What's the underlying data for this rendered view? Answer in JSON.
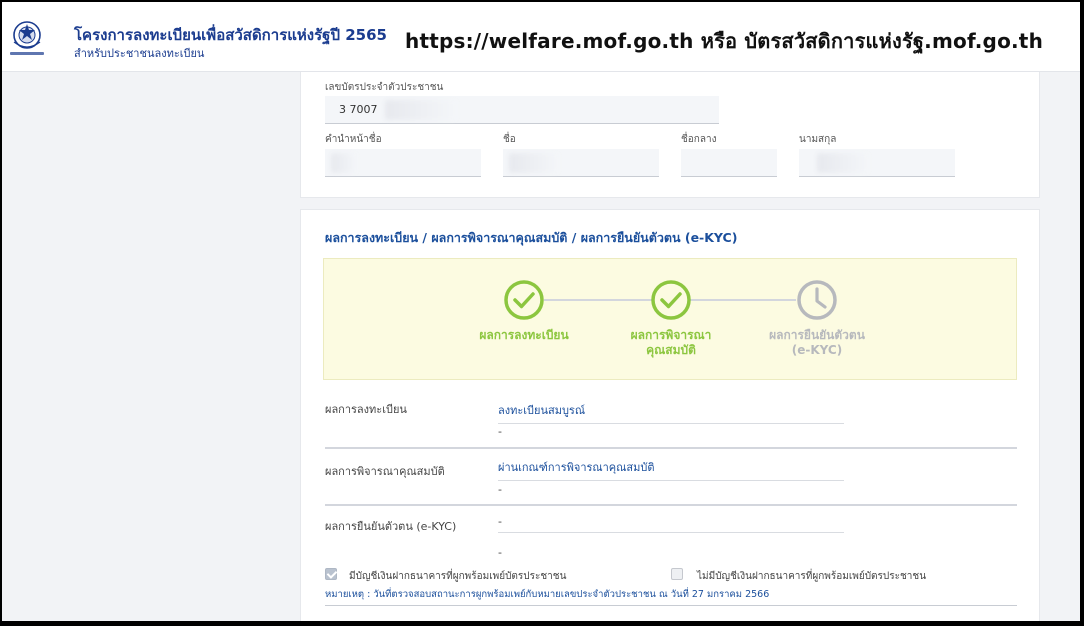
{
  "header": {
    "title": "โครงการลงทะเบียนเพื่อสวัสดิการแห่งรัฐปี 2565",
    "subtitle": "สำหรับประชาชนลงทะเบียน",
    "url_banner": "https://welfare.mof.go.th หรือ บัตรสวัสดิการแห่งรัฐ.mof.go.th",
    "logo_icon": "ministry-of-finance-seal-icon"
  },
  "id_card": {
    "label": "เลขบัตรประจำตัวประชาชน",
    "value": "3 7007"
  },
  "name": {
    "prefix_label": "คำนำหน้าชื่อ",
    "first_label": "ชื่อ",
    "middle_label": "ชื่อกลาง",
    "last_label": "นามสกุล"
  },
  "results": {
    "section_title": "ผลการลงทะเบียน / ผลการพิจารณาคุณสมบัติ / ผลการยืนยันตัวตน (e-KYC)",
    "steps": [
      {
        "label_line1": "ผลการลงทะเบียน",
        "label_line2": "",
        "status": "done",
        "icon": "check-circle-icon",
        "color": "#8cc63f"
      },
      {
        "label_line1": "ผลการพิจารณา",
        "label_line2": "คุณสมบัติ",
        "status": "done",
        "icon": "check-circle-icon",
        "color": "#8cc63f"
      },
      {
        "label_line1": "ผลการยืนยันตัวตน",
        "label_line2": "(e-KYC)",
        "status": "pending",
        "icon": "clock-icon",
        "color": "#b7b9bd"
      }
    ],
    "rows": [
      {
        "label": "ผลการลงทะเบียน",
        "value": "ลงทะเบียนสมบูรณ์",
        "detail": "-"
      },
      {
        "label": "ผลการพิจารณาคุณสมบัติ",
        "value": "ผ่านเกณฑ์การพิจารณาคุณสมบัติ",
        "detail": "-"
      },
      {
        "label": "ผลการยืนยันตัวตน (e-KYC)",
        "value": "-",
        "detail": "-"
      }
    ],
    "has_account_label": "มีบัญชีเงินฝากธนาคารที่ผูกพร้อมเพย์บัตรประชาชน",
    "has_account_checked": true,
    "no_account_label": "ไม่มีบัญชีเงินฝากธนาคารที่ผูกพร้อมเพย์บัตรประชาชน",
    "no_account_checked": false,
    "note": "หมายเหตุ : วันที่ตรวจสอบสถานะการผูกพร้อมเพย์กับหมายเลขประจำตัวประชาชน ณ วันที่ 27 มกราคม 2566"
  }
}
